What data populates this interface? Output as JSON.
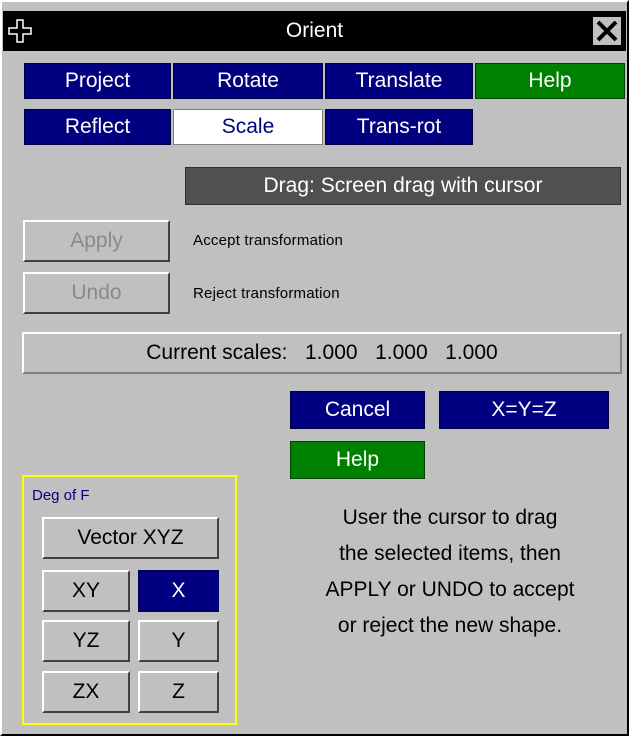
{
  "window": {
    "title": "Orient",
    "move_icon": "move-icon",
    "close_icon": "close-icon"
  },
  "tabs": {
    "project": "Project",
    "rotate": "Rotate",
    "translate": "Translate",
    "help": "Help",
    "reflect": "Reflect",
    "scale": "Scale",
    "trans_rot": "Trans-rot"
  },
  "drag_mode": "Drag: Screen drag with cursor",
  "actions": {
    "apply": "Apply",
    "apply_desc": "Accept transformation",
    "undo": "Undo",
    "undo_desc": "Reject transformation"
  },
  "scales": {
    "label": "Current scales:",
    "x": "1.000",
    "y": "1.000",
    "z": "1.000"
  },
  "buttons": {
    "cancel": "Cancel",
    "xyz_equal": "X=Y=Z",
    "help": "Help"
  },
  "dof": {
    "title": "Deg of F",
    "vector": "Vector XYZ",
    "xy": "XY",
    "x": "X",
    "yz": "YZ",
    "y": "Y",
    "zx": "ZX",
    "z": "Z",
    "selected": "X"
  },
  "instructions": [
    "User the cursor to drag",
    "the selected items, then",
    "APPLY or UNDO to accept",
    "or reject the new shape."
  ],
  "colors": {
    "tab_active": "#000080",
    "tab_selected": "#ffffff",
    "help_green": "#008000",
    "panel_bg": "#c0c0c0",
    "dof_border": "#ffff00"
  }
}
